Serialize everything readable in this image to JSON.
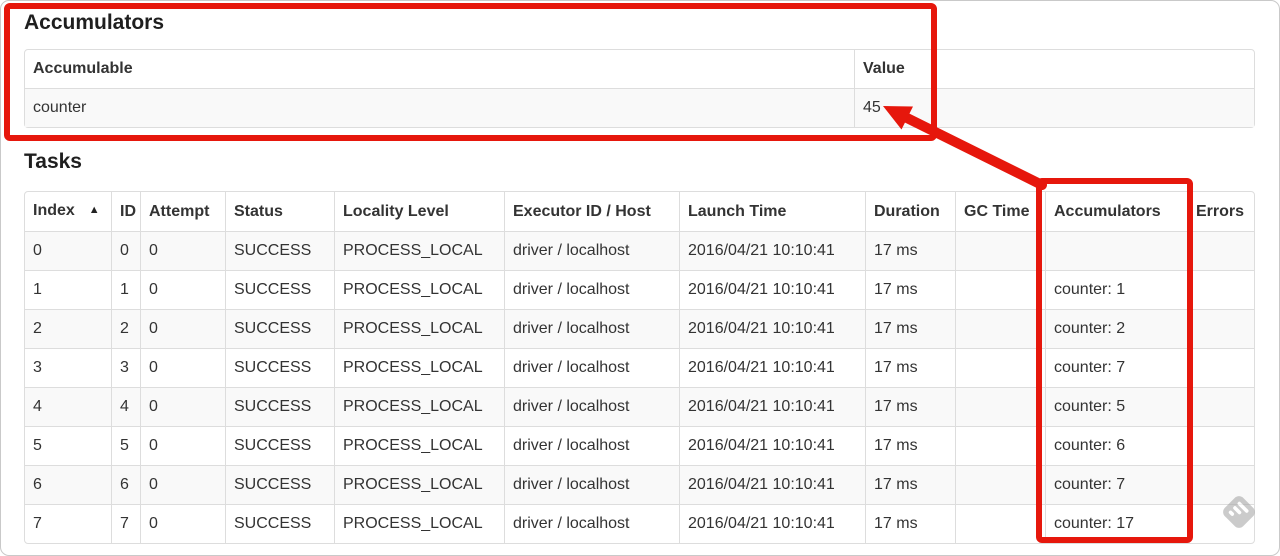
{
  "annotations": {
    "highlight_color": "#e6170c"
  },
  "icons": {
    "sort_ascending": "▲",
    "watermark": "stamp-diamond"
  },
  "accumulators_section": {
    "title": "Accumulators",
    "columns": [
      "Accumulable",
      "Value"
    ],
    "rows": [
      [
        "counter",
        "45"
      ]
    ]
  },
  "tasks_section": {
    "title": "Tasks",
    "columns": [
      "Index",
      "ID",
      "Attempt",
      "Status",
      "Locality Level",
      "Executor ID / Host",
      "Launch Time",
      "Duration",
      "GC Time",
      "Accumulators",
      "Errors"
    ],
    "sorted_column": "Index",
    "rows": [
      [
        "0",
        "0",
        "0",
        "SUCCESS",
        "PROCESS_LOCAL",
        "driver / localhost",
        "2016/04/21 10:10:41",
        "17 ms",
        "",
        "",
        ""
      ],
      [
        "1",
        "1",
        "0",
        "SUCCESS",
        "PROCESS_LOCAL",
        "driver / localhost",
        "2016/04/21 10:10:41",
        "17 ms",
        "",
        "counter: 1",
        ""
      ],
      [
        "2",
        "2",
        "0",
        "SUCCESS",
        "PROCESS_LOCAL",
        "driver / localhost",
        "2016/04/21 10:10:41",
        "17 ms",
        "",
        "counter: 2",
        ""
      ],
      [
        "3",
        "3",
        "0",
        "SUCCESS",
        "PROCESS_LOCAL",
        "driver / localhost",
        "2016/04/21 10:10:41",
        "17 ms",
        "",
        "counter: 7",
        ""
      ],
      [
        "4",
        "4",
        "0",
        "SUCCESS",
        "PROCESS_LOCAL",
        "driver / localhost",
        "2016/04/21 10:10:41",
        "17 ms",
        "",
        "counter: 5",
        ""
      ],
      [
        "5",
        "5",
        "0",
        "SUCCESS",
        "PROCESS_LOCAL",
        "driver / localhost",
        "2016/04/21 10:10:41",
        "17 ms",
        "",
        "counter: 6",
        ""
      ],
      [
        "6",
        "6",
        "0",
        "SUCCESS",
        "PROCESS_LOCAL",
        "driver / localhost",
        "2016/04/21 10:10:41",
        "17 ms",
        "",
        "counter: 7",
        ""
      ],
      [
        "7",
        "7",
        "0",
        "SUCCESS",
        "PROCESS_LOCAL",
        "driver / localhost",
        "2016/04/21 10:10:41",
        "17 ms",
        "",
        "counter: 17",
        ""
      ]
    ]
  }
}
